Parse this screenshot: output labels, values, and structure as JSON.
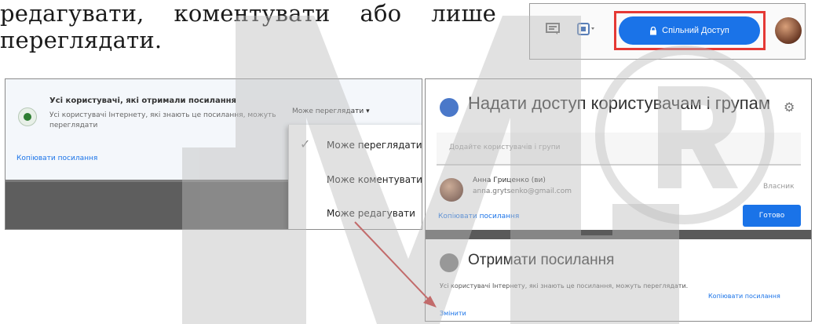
{
  "intro": {
    "line1_words": [
      "редагувати,",
      "коментувати",
      "або",
      "лише"
    ],
    "line2": "переглядати."
  },
  "toolbar": {
    "share_label": "Спільний Доступ",
    "share_icon": "lock-icon",
    "icons": [
      "comment-icon",
      "present-icon",
      "chevron-down-icon"
    ]
  },
  "left_panel": {
    "access_title": "Усі користувачі, які отримали посилання",
    "access_desc": "Усі користувачі Інтернету, які знають це посилання, можуть переглядати",
    "role_button": "Може переглядати",
    "copy_link": "Копіювати посилання",
    "dropdown": [
      "Може переглядати",
      "Може коментувати",
      "Може редагувати"
    ]
  },
  "right_panel": {
    "title": "Надати доступ користувачам і групам",
    "add_placeholder": "Додайте користувачів і групи",
    "person_name": "Анна Гриценко (ви)",
    "person_email": "anna.grytsenko@gmail.com",
    "owner_label": "Власник",
    "copy_link": "Копіювати посилання",
    "done_button": "Готово",
    "get_link_title": "Отримати посилання",
    "get_link_desc": "Усі користувачі Інтернету, які знають це посилання, можуть переглядати.",
    "copy_link_right": "Копіювати посилання",
    "change_link": "Змінити"
  },
  "colors": {
    "accent": "#1a73e8",
    "highlight": "#e53935",
    "arrow": "#c62828"
  }
}
